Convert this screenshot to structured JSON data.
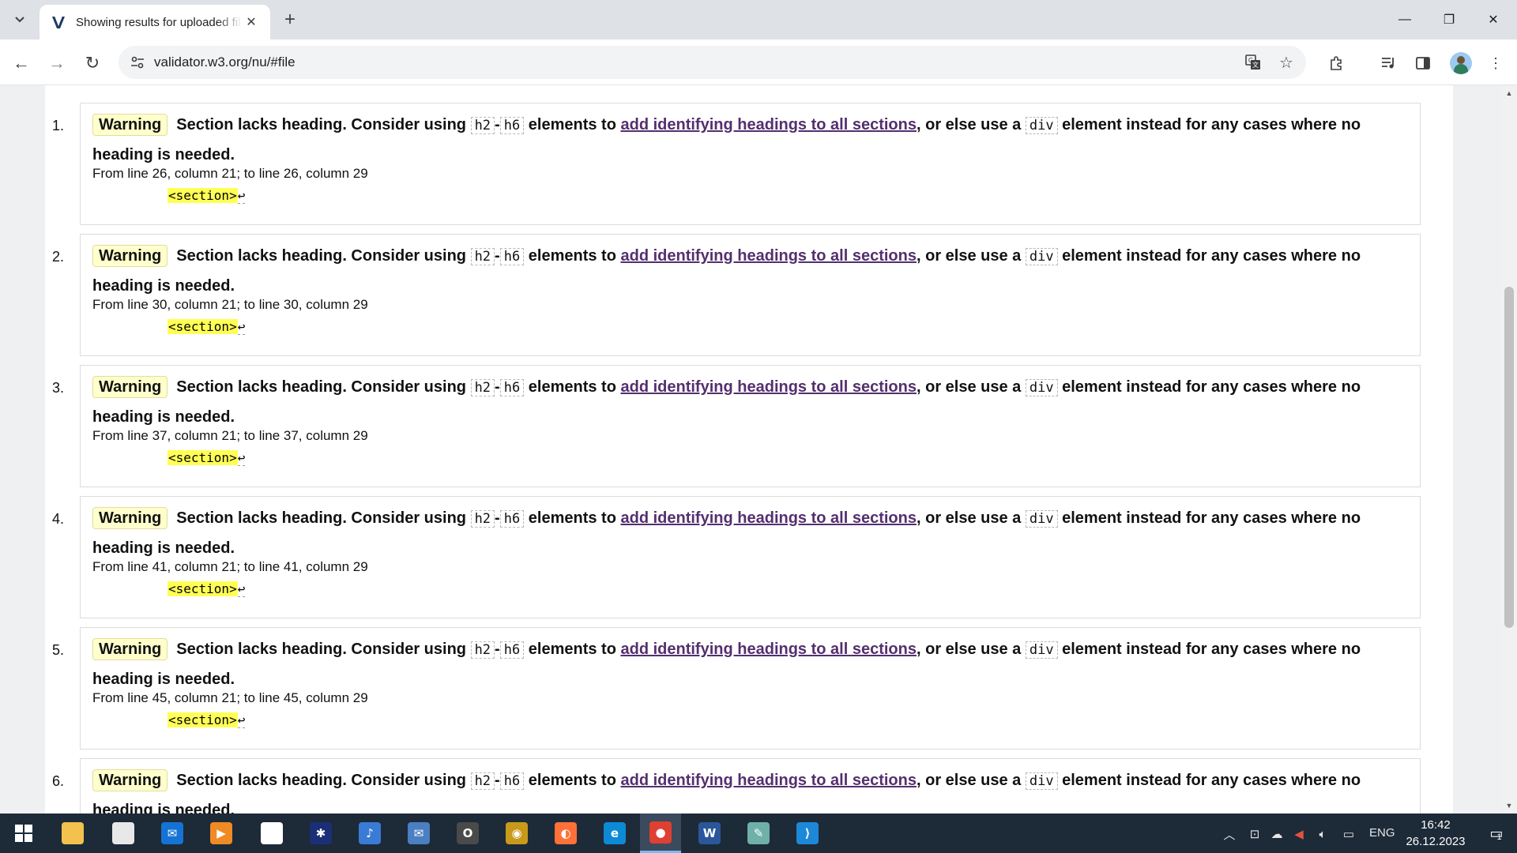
{
  "browser": {
    "tab_title": "Showing results for uploaded file",
    "url": "validator.w3.org/nu/#file",
    "tab_close_glyph": "✕",
    "new_tab_glyph": "+"
  },
  "window_controls": {
    "minimize": "—",
    "restore": "❐",
    "close": "✕"
  },
  "nav": {
    "back": "←",
    "forward": "→",
    "reload": "↻"
  },
  "messages": [
    {
      "number": "1.",
      "type": "Warning",
      "text_before": "Section lacks heading. Consider using",
      "code_h2": "h2",
      "dash": "-",
      "code_h6": "h6",
      "text_elements_to": "elements to",
      "link": "add identifying headings to all sections",
      "text_or_else": ", or else use a",
      "code_div": "div",
      "text_after": "element instead for any cases where no heading is needed.",
      "location": "From line 26, column 21; to line 26, column 29",
      "extract": "<section>",
      "return_glyph": "↩"
    },
    {
      "number": "2.",
      "type": "Warning",
      "text_before": "Section lacks heading. Consider using",
      "code_h2": "h2",
      "dash": "-",
      "code_h6": "h6",
      "text_elements_to": "elements to",
      "link": "add identifying headings to all sections",
      "text_or_else": ", or else use a",
      "code_div": "div",
      "text_after": "element instead for any cases where no heading is needed.",
      "location": "From line 30, column 21; to line 30, column 29",
      "extract": "<section>",
      "return_glyph": "↩"
    },
    {
      "number": "3.",
      "type": "Warning",
      "text_before": "Section lacks heading. Consider using",
      "code_h2": "h2",
      "dash": "-",
      "code_h6": "h6",
      "text_elements_to": "elements to",
      "link": "add identifying headings to all sections",
      "text_or_else": ", or else use a",
      "code_div": "div",
      "text_after": "element instead for any cases where no heading is needed.",
      "location": "From line 37, column 21; to line 37, column 29",
      "extract": "<section>",
      "return_glyph": "↩"
    },
    {
      "number": "4.",
      "type": "Warning",
      "text_before": "Section lacks heading. Consider using",
      "code_h2": "h2",
      "dash": "-",
      "code_h6": "h6",
      "text_elements_to": "elements to",
      "link": "add identifying headings to all sections",
      "text_or_else": ", or else use a",
      "code_div": "div",
      "text_after": "element instead for any cases where no heading is needed.",
      "location": "From line 41, column 21; to line 41, column 29",
      "extract": "<section>",
      "return_glyph": "↩"
    },
    {
      "number": "5.",
      "type": "Warning",
      "text_before": "Section lacks heading. Consider using",
      "code_h2": "h2",
      "dash": "-",
      "code_h6": "h6",
      "text_elements_to": "elements to",
      "link": "add identifying headings to all sections",
      "text_or_else": ", or else use a",
      "code_div": "div",
      "text_after": "element instead for any cases where no heading is needed.",
      "location": "From line 45, column 21; to line 45, column 29",
      "extract": "<section>",
      "return_glyph": "↩"
    },
    {
      "number": "6.",
      "type": "Warning",
      "text_before": "Section lacks heading. Consider using",
      "code_h2": "h2",
      "dash": "-",
      "code_h6": "h6",
      "text_elements_to": "elements to",
      "link": "add identifying headings to all sections",
      "text_or_else": ", or else use a",
      "code_div": "div",
      "text_after": "element instead for any cases where no heading is needed.",
      "location": "",
      "extract": "",
      "return_glyph": ""
    }
  ],
  "taskbar": {
    "apps": [
      {
        "name": "file-explorer",
        "glyph": "",
        "color": "#f2c14e"
      },
      {
        "name": "microsoft-store",
        "glyph": "",
        "color": "#e8e8e8"
      },
      {
        "name": "mail",
        "glyph": "✉",
        "color": "#1473d4"
      },
      {
        "name": "media-player",
        "glyph": "▶",
        "color": "#f08a24"
      },
      {
        "name": "notepad",
        "glyph": "",
        "color": "#ffffff"
      },
      {
        "name": "paint-app",
        "glyph": "✱",
        "color": "#1b2f77"
      },
      {
        "name": "audio-app",
        "glyph": "♪",
        "color": "#3a7bd5"
      },
      {
        "name": "mail-client",
        "glyph": "✉",
        "color": "#4a7fc1"
      },
      {
        "name": "outlook",
        "glyph": "O",
        "color": "#4a4a4a"
      },
      {
        "name": "eye-app",
        "glyph": "◉",
        "color": "#c79a1c"
      },
      {
        "name": "firefox",
        "glyph": "◐",
        "color": "#ff7139"
      },
      {
        "name": "edge",
        "glyph": "e",
        "color": "#0c8ad6"
      },
      {
        "name": "chrome",
        "glyph": "●",
        "color": "#de4032"
      },
      {
        "name": "word",
        "glyph": "W",
        "color": "#2b579a"
      },
      {
        "name": "pen-app",
        "glyph": "✎",
        "color": "#6fb1a8"
      },
      {
        "name": "vscode",
        "glyph": "⟩",
        "color": "#1e88d8"
      }
    ],
    "lang": "ENG",
    "time": "16:42",
    "date": "26.12.2023",
    "notification_count": "1"
  }
}
